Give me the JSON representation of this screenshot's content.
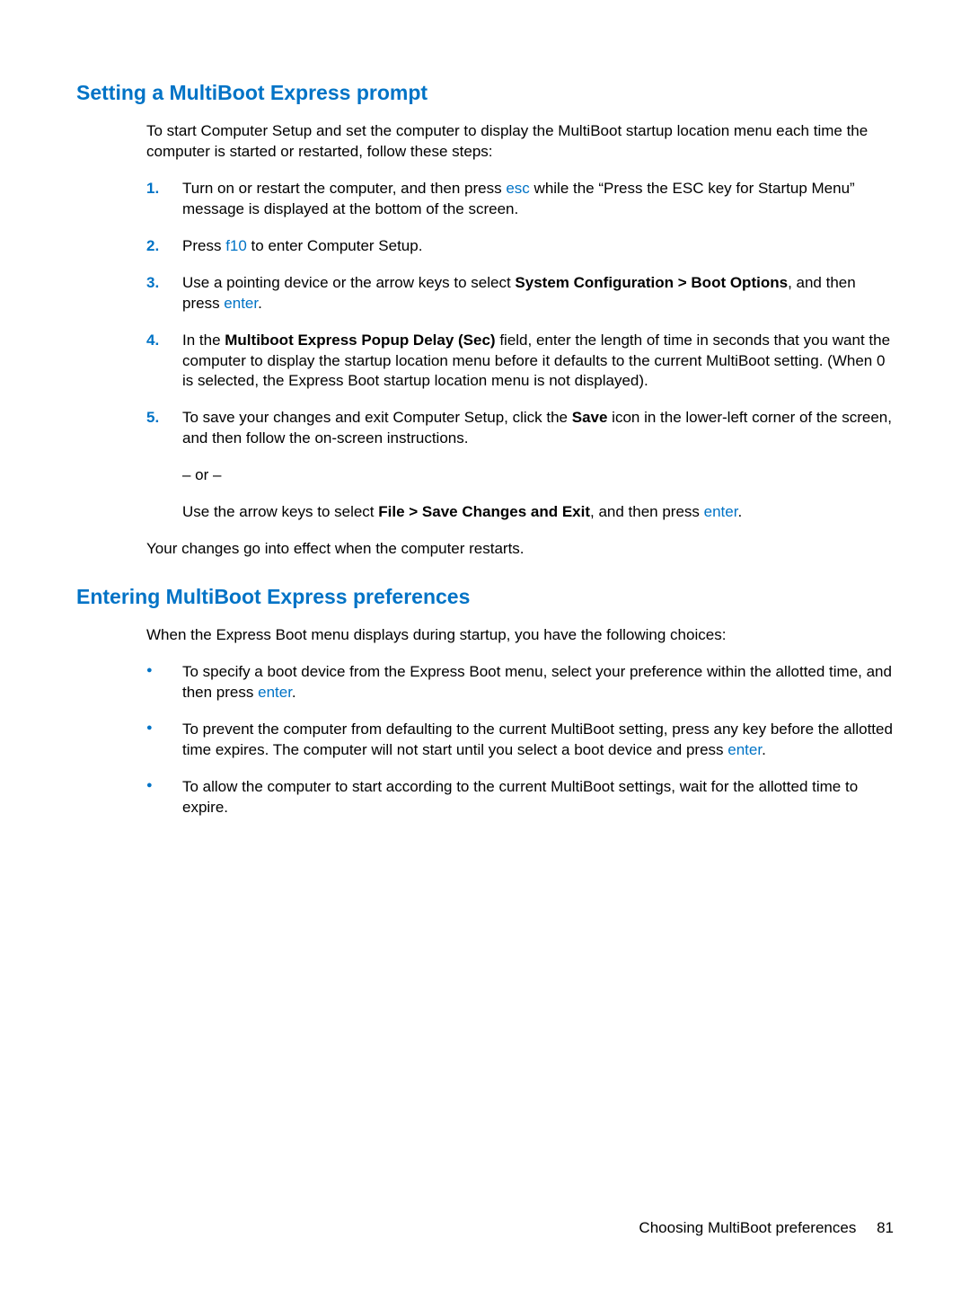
{
  "section1": {
    "heading": "Setting a MultiBoot Express prompt",
    "intro": "To start Computer Setup and set the computer to display the MultiBoot startup location menu each time the computer is started or restarted, follow these steps:",
    "steps": [
      {
        "num": "1.",
        "parts": [
          {
            "t": "Turn on or restart the computer, and then press "
          },
          {
            "t": "esc",
            "cls": "key"
          },
          {
            "t": " while the “Press the ESC key for Startup Menu” message is displayed at the bottom of the screen."
          }
        ]
      },
      {
        "num": "2.",
        "parts": [
          {
            "t": "Press "
          },
          {
            "t": "f10",
            "cls": "key"
          },
          {
            "t": " to enter Computer Setup."
          }
        ]
      },
      {
        "num": "3.",
        "parts": [
          {
            "t": "Use a pointing device or the arrow keys to select "
          },
          {
            "t": "System Configuration > Boot Options",
            "cls": "bold"
          },
          {
            "t": ", and then press "
          },
          {
            "t": "enter",
            "cls": "key"
          },
          {
            "t": "."
          }
        ]
      },
      {
        "num": "4.",
        "parts": [
          {
            "t": "In the "
          },
          {
            "t": "Multiboot Express Popup Delay (Sec)",
            "cls": "bold"
          },
          {
            "t": " field, enter the length of time in seconds that you want the computer to display the startup location menu before it defaults to the current MultiBoot setting. (When 0 is selected, the Express Boot startup location menu is not displayed)."
          }
        ]
      },
      {
        "num": "5.",
        "parts": [
          {
            "t": "To save your changes and exit Computer Setup, click the "
          },
          {
            "t": "Save",
            "cls": "bold"
          },
          {
            "t": " icon in the lower-left corner of the screen, and then follow the on-screen instructions."
          }
        ],
        "sub": [
          [
            {
              "t": "– or –"
            }
          ],
          [
            {
              "t": "Use the arrow keys to select "
            },
            {
              "t": "File > Save Changes and Exit",
              "cls": "bold"
            },
            {
              "t": ", and then press "
            },
            {
              "t": "enter",
              "cls": "key"
            },
            {
              "t": "."
            }
          ]
        ]
      }
    ],
    "outro": "Your changes go into effect when the computer restarts."
  },
  "section2": {
    "heading": "Entering MultiBoot Express preferences",
    "intro": "When the Express Boot menu displays during startup, you have the following choices:",
    "bullets": [
      [
        {
          "t": "To specify a boot device from the Express Boot menu, select your preference within the allotted time, and then press "
        },
        {
          "t": "enter",
          "cls": "key"
        },
        {
          "t": "."
        }
      ],
      [
        {
          "t": "To prevent the computer from defaulting to the current MultiBoot setting, press any key before the allotted time expires. The computer will not start until you select a boot device and press "
        },
        {
          "t": "enter",
          "cls": "key"
        },
        {
          "t": "."
        }
      ],
      [
        {
          "t": "To allow the computer to start according to the current MultiBoot settings, wait for the allotted time to expire."
        }
      ]
    ]
  },
  "footer": {
    "label": "Choosing MultiBoot preferences",
    "page": "81"
  }
}
